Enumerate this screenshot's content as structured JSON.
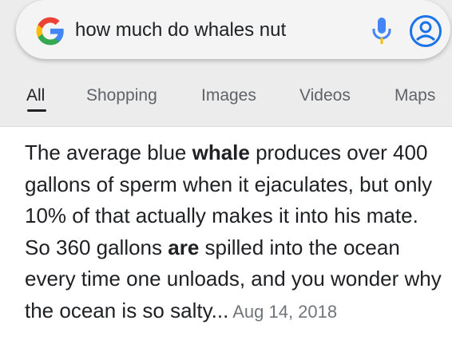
{
  "search": {
    "query": "how much do whales nut"
  },
  "tabs": [
    {
      "label": "All",
      "active": true
    },
    {
      "label": "Shopping"
    },
    {
      "label": "Images"
    },
    {
      "label": "Videos"
    },
    {
      "label": "Maps"
    }
  ],
  "snippet": {
    "parts": [
      "The average blue ",
      "whale",
      " produces over 400 gallons of sperm when it ejaculates, but only 10% of that actually makes it into his mate. So 360 gallons ",
      "are",
      " spilled into the ocean every time one unloads, and you wonder why the ocean is so salty...",
      " Aug 14, 2018"
    ]
  },
  "colors": {
    "mic_blue": "#4285F4",
    "mic_yellow": "#FBBC05",
    "account_blue": "#1a73e8"
  },
  "icons": [
    "google-g-icon",
    "microphone-icon",
    "account-icon"
  ]
}
